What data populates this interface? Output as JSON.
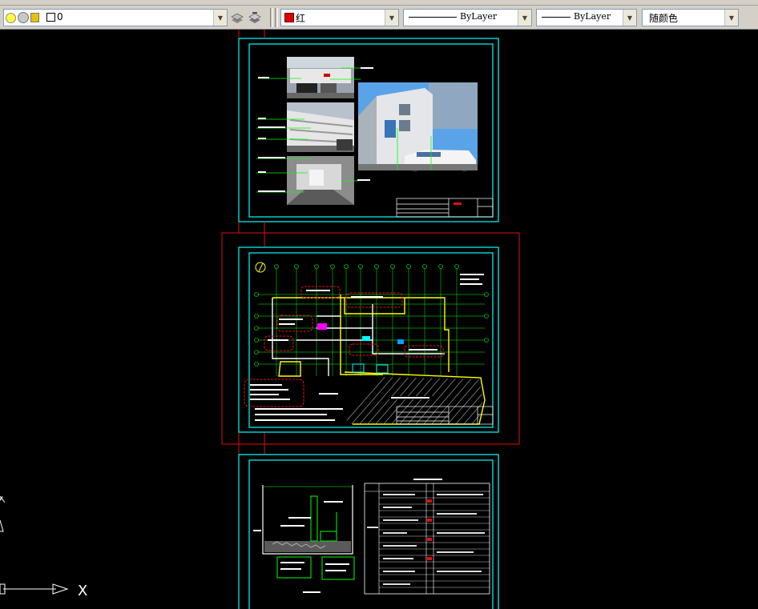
{
  "toolbar": {
    "layer_name": "0",
    "color_value": "红",
    "color_hex": "#e00000",
    "linetype_value": "ByLayer",
    "lineweight_value": "ByLayer",
    "plotstyle_value": "随颜色"
  },
  "canvas": {
    "background": "#000000",
    "sheet_border_color": "#00ffff",
    "selection_color": "#e01010",
    "ucs_x_label": "X",
    "ucs_y_label": "Y"
  }
}
